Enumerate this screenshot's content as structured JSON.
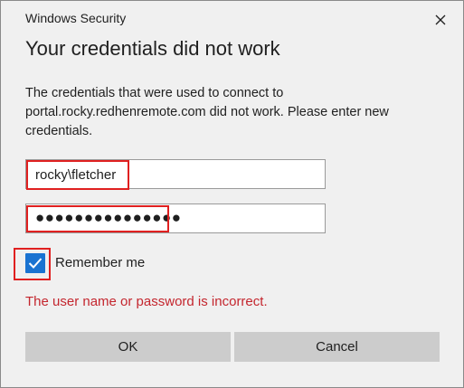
{
  "window": {
    "title": "Windows Security",
    "close_icon": "close-icon"
  },
  "heading": "Your credentials did not work",
  "description": "The credentials that were used to connect to portal.rocky.redhenremote.com did not work. Please enter new credentials.",
  "username": {
    "value": "rocky\\fletcher"
  },
  "password": {
    "masked_value": "●●●●●●●●●●●●●●●"
  },
  "remember_me": {
    "label": "Remember me",
    "checked": true
  },
  "error_message": "The user name or password is incorrect.",
  "buttons": {
    "ok": "OK",
    "cancel": "Cancel"
  },
  "colors": {
    "dialog_background": "#f0f0f0",
    "checkbox_accent": "#1a73d1",
    "error_text": "#c4262e",
    "highlight_border": "#e02020",
    "button_background": "#cccccc"
  }
}
